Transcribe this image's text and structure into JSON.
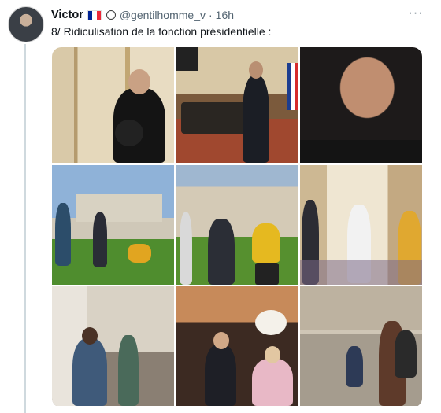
{
  "tweet": {
    "author_name": "Victor",
    "flag": [
      "#002395",
      "#ffffff",
      "#ed2939"
    ],
    "handle": "@gentilhomme_v",
    "separator": "·",
    "time": "16h",
    "badge_glyph": "⦿",
    "more_glyph": "···",
    "text": "8/ Ridiculisation de la fonction présidentielle :"
  },
  "icons": {
    "verified_like_badge": "circle-badge-icon",
    "more": "more-options-icon"
  },
  "media": {
    "count": 9,
    "photos": [
      {
        "name": "photo-salon-hoodie"
      },
      {
        "name": "photo-office-desk"
      },
      {
        "name": "photo-closeup-face"
      },
      {
        "name": "photo-lawn-dancer"
      },
      {
        "name": "photo-lawn-group"
      },
      {
        "name": "photo-hall-group"
      },
      {
        "name": "photo-dancer-pose"
      },
      {
        "name": "photo-group-sofa"
      },
      {
        "name": "photo-dancer-courtyard"
      }
    ]
  }
}
